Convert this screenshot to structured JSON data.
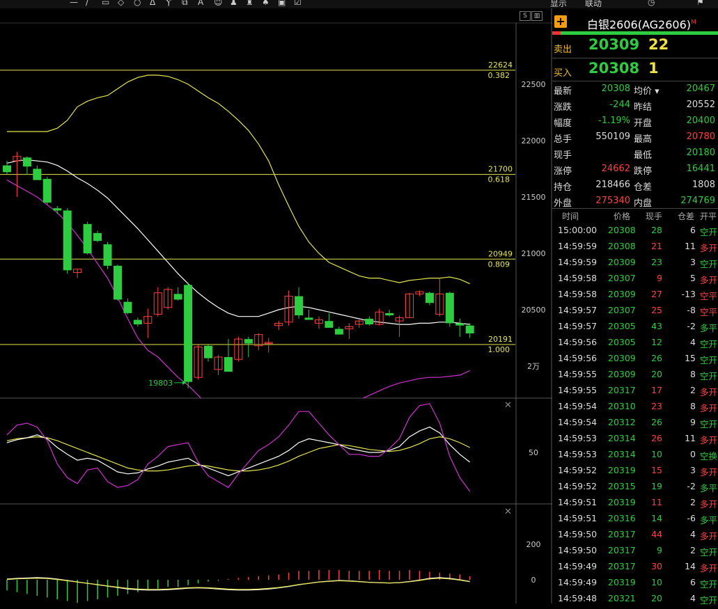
{
  "toolbar": {
    "items": [
      "—",
      "/",
      "▭",
      "◇",
      "○",
      "ᐃ",
      "Ⲩ",
      "⧉",
      "A",
      "☺",
      "♟",
      "♜",
      "♠",
      "▣",
      "☑"
    ],
    "right_items": [
      "显示",
      "联动",
      "◷",
      "⚑"
    ]
  },
  "chart": {
    "y_ticks": [
      {
        "label": "22500",
        "v": 22500
      },
      {
        "label": "22000",
        "v": 22000
      },
      {
        "label": "21500",
        "v": 21500
      },
      {
        "label": "21000",
        "v": 21000
      },
      {
        "label": "20500",
        "v": 20500
      },
      {
        "label": "2万",
        "v": 20000
      }
    ],
    "fib_levels": [
      {
        "price": "22624",
        "ratio": "0.382",
        "v": 22624
      },
      {
        "price": "21700",
        "ratio": "0.618",
        "v": 21700
      },
      {
        "price": "20949",
        "ratio": "0.809",
        "v": 20949
      },
      {
        "price": "20191",
        "ratio": "1.000",
        "v": 20191
      }
    ],
    "low_marker": "19803",
    "low_value": 19803,
    "kdj_tick": "50",
    "macd_ticks": [
      "200",
      "0"
    ],
    "colors": {
      "up": "#ff4040",
      "down": "#2ecc40",
      "fib": "#e6e64c",
      "upper_band": "#e6e64c",
      "mid": "#ffffff",
      "lower_band": "#d030d0"
    }
  },
  "chart_data": {
    "type": "candlestick",
    "candles": [
      {
        "o": 21780,
        "h": 21820,
        "l": 21700,
        "c": 21720
      },
      {
        "o": 21820,
        "h": 21900,
        "l": 21500,
        "c": 21860
      },
      {
        "o": 21850,
        "h": 21860,
        "l": 21700,
        "c": 21770
      },
      {
        "o": 21750,
        "h": 21780,
        "l": 21650,
        "c": 21650
      },
      {
        "o": 21660,
        "h": 21680,
        "l": 21430,
        "c": 21450
      },
      {
        "o": 21400,
        "h": 21420,
        "l": 21350,
        "c": 21380
      },
      {
        "o": 21380,
        "h": 21400,
        "l": 20820,
        "c": 20850
      },
      {
        "o": 20830,
        "h": 20860,
        "l": 20780,
        "c": 20860
      },
      {
        "o": 21260,
        "h": 21280,
        "l": 20990,
        "c": 21000
      },
      {
        "o": 21180,
        "h": 21200,
        "l": 21100,
        "c": 21110
      },
      {
        "o": 21080,
        "h": 21100,
        "l": 20860,
        "c": 20890
      },
      {
        "o": 20890,
        "h": 20900,
        "l": 20580,
        "c": 20590
      },
      {
        "o": 20570,
        "h": 20600,
        "l": 20460,
        "c": 20470
      },
      {
        "o": 20410,
        "h": 20430,
        "l": 20350,
        "c": 20370
      },
      {
        "o": 20380,
        "h": 20510,
        "l": 20250,
        "c": 20440
      },
      {
        "o": 20460,
        "h": 20700,
        "l": 20440,
        "c": 20650
      },
      {
        "o": 20520,
        "h": 20700,
        "l": 20500,
        "c": 20680
      },
      {
        "o": 20640,
        "h": 20700,
        "l": 20580,
        "c": 20590
      },
      {
        "o": 20720,
        "h": 20740,
        "l": 19803,
        "c": 19860
      },
      {
        "o": 19900,
        "h": 20190,
        "l": 19880,
        "c": 20170
      },
      {
        "o": 20180,
        "h": 20190,
        "l": 20040,
        "c": 20070
      },
      {
        "o": 19970,
        "h": 20100,
        "l": 19920,
        "c": 20080
      },
      {
        "o": 20080,
        "h": 20240,
        "l": 20040,
        "c": 19950
      },
      {
        "o": 20060,
        "h": 20260,
        "l": 20040,
        "c": 20240
      },
      {
        "o": 20240,
        "h": 20260,
        "l": 20080,
        "c": 20200
      },
      {
        "o": 20180,
        "h": 20290,
        "l": 20140,
        "c": 20280
      },
      {
        "o": 20200,
        "h": 20250,
        "l": 20120,
        "c": 20210
      },
      {
        "o": 20360,
        "h": 20400,
        "l": 20320,
        "c": 20380
      },
      {
        "o": 20390,
        "h": 20670,
        "l": 20360,
        "c": 20620
      },
      {
        "o": 20620,
        "h": 20700,
        "l": 20420,
        "c": 20450
      },
      {
        "o": 20430,
        "h": 20500,
        "l": 20420,
        "c": 20410
      },
      {
        "o": 20380,
        "h": 20440,
        "l": 20330,
        "c": 20410
      },
      {
        "o": 20400,
        "h": 20470,
        "l": 20350,
        "c": 20340
      },
      {
        "o": 20330,
        "h": 20350,
        "l": 20280,
        "c": 20280
      },
      {
        "o": 20330,
        "h": 20380,
        "l": 20240,
        "c": 20350
      },
      {
        "o": 20370,
        "h": 20420,
        "l": 20340,
        "c": 20400
      },
      {
        "o": 20420,
        "h": 20440,
        "l": 20360,
        "c": 20370
      },
      {
        "o": 20370,
        "h": 20510,
        "l": 20360,
        "c": 20480
      },
      {
        "o": 20470,
        "h": 20500,
        "l": 20440,
        "c": 20450
      },
      {
        "o": 20400,
        "h": 20450,
        "l": 20260,
        "c": 20430
      },
      {
        "o": 20430,
        "h": 20650,
        "l": 20430,
        "c": 20640
      },
      {
        "o": 20640,
        "h": 20670,
        "l": 20620,
        "c": 20660
      },
      {
        "o": 20650,
        "h": 20660,
        "l": 20540,
        "c": 20560
      },
      {
        "o": 20460,
        "h": 20780,
        "l": 20440,
        "c": 20640
      },
      {
        "o": 20650,
        "h": 20660,
        "l": 20350,
        "c": 20380
      },
      {
        "o": 20380,
        "h": 20420,
        "l": 20260,
        "c": 20360
      },
      {
        "o": 20360,
        "h": 20380,
        "l": 20250,
        "c": 20290
      }
    ],
    "upper_band": [
      22080,
      22080,
      22080,
      22080,
      22080,
      22110,
      22180,
      22300,
      22350,
      22380,
      22400,
      22460,
      22520,
      22560,
      22580,
      22580,
      22570,
      22540,
      22500,
      22440,
      22380,
      22330,
      22260,
      22180,
      22090,
      21970,
      21820,
      21610,
      21420,
      21240,
      21100,
      21000,
      20920,
      20880,
      20840,
      20800,
      20780,
      20780,
      20760,
      20740,
      20760,
      20770,
      20780,
      20780,
      20790,
      20770,
      20730
    ],
    "mid_band": [
      21800,
      21820,
      21830,
      21820,
      21810,
      21780,
      21730,
      21670,
      21620,
      21560,
      21490,
      21400,
      21310,
      21220,
      21120,
      21020,
      20920,
      20820,
      20730,
      20650,
      20580,
      20520,
      20470,
      20440,
      20440,
      20440,
      20470,
      20500,
      20520,
      20530,
      20520,
      20500,
      20480,
      20460,
      20440,
      20420,
      20400,
      20390,
      20380,
      20370,
      20370,
      20380,
      20380,
      20390,
      20390,
      20380,
      20370
    ],
    "lower_band": [
      21650,
      21600,
      21550,
      21500,
      21430,
      21360,
      21270,
      21160,
      21040,
      20910,
      20780,
      20610,
      20420,
      20250,
      20140,
      20080,
      19990,
      19900,
      19830,
      19740,
      19650,
      19580,
      19510,
      19460,
      19430,
      19420,
      19420,
      19460,
      19500,
      19540,
      19600,
      19630,
      19640,
      19640,
      19660,
      19700,
      19740,
      19780,
      19820,
      19850,
      19870,
      19890,
      19900,
      19900,
      19910,
      19920,
      19960
    ],
    "kdj_k": [
      60,
      63,
      65,
      68,
      64,
      55,
      48,
      42,
      44,
      42,
      36,
      30,
      28,
      29,
      33,
      36,
      40,
      42,
      44,
      38,
      34,
      30,
      26,
      30,
      34,
      38,
      42,
      46,
      52,
      60,
      64,
      62,
      60,
      58,
      54,
      52,
      50,
      50,
      52,
      56,
      66,
      72,
      76,
      70,
      58,
      48,
      40
    ],
    "kdj_d": [
      62,
      64,
      65,
      66,
      65,
      62,
      58,
      54,
      50,
      46,
      42,
      38,
      34,
      32,
      31,
      31,
      32,
      34,
      36,
      37,
      36,
      34,
      32,
      31,
      31,
      32,
      34,
      37,
      41,
      46,
      50,
      54,
      56,
      58,
      57,
      55,
      53,
      52,
      51,
      52,
      55,
      59,
      64,
      66,
      64,
      60,
      55
    ],
    "kdj_j": [
      68,
      78,
      80,
      76,
      62,
      38,
      24,
      18,
      32,
      34,
      20,
      14,
      16,
      22,
      38,
      46,
      56,
      58,
      60,
      40,
      26,
      20,
      14,
      28,
      40,
      52,
      58,
      66,
      78,
      92,
      92,
      80,
      68,
      58,
      48,
      48,
      46,
      46,
      54,
      64,
      86,
      98,
      100,
      80,
      46,
      24,
      10
    ],
    "macd_hist": [
      -60,
      -70,
      -80,
      -90,
      -100,
      -110,
      -120,
      -130,
      -120,
      -110,
      -100,
      -90,
      -80,
      -70,
      -60,
      -50,
      -40,
      -40,
      -30,
      -20,
      -10,
      -5,
      5,
      10,
      15,
      20,
      25,
      30,
      40,
      50,
      50,
      55,
      55,
      55,
      50,
      50,
      50,
      55,
      50,
      50,
      55,
      50,
      45,
      40,
      35,
      30,
      20
    ]
  },
  "right_panel": {
    "title": "白银2606(AG2606)",
    "title_sup": "M",
    "sell_label": "卖出",
    "sell_price": "20309",
    "sell_vol": "22",
    "buy_label": "买入",
    "buy_price": "20308",
    "buy_vol": "1",
    "quotes": [
      {
        "l1": "最新",
        "v1": "20308",
        "c1": "g",
        "l2": "均价 ▾",
        "v2": "20467",
        "c2": "g"
      },
      {
        "l1": "涨跌",
        "v1": "-244",
        "c1": "g",
        "l2": "昨结",
        "v2": "20552",
        "c2": "w"
      },
      {
        "l1": "幅度",
        "v1": "-1.19%",
        "c1": "g",
        "l2": "开盘",
        "v2": "20400",
        "c2": "g"
      },
      {
        "l1": "总手",
        "v1": "550109",
        "c1": "w",
        "l2": "最高",
        "v2": "20780",
        "c2": "r"
      },
      {
        "l1": "现手",
        "v1": "",
        "c1": "w",
        "l2": "最低",
        "v2": "20180",
        "c2": "g"
      },
      {
        "l1": "涨停",
        "v1": "24662",
        "c1": "r",
        "l2": "跌停",
        "v2": "16441",
        "c2": "g"
      },
      {
        "l1": "持仓",
        "v1": "218466",
        "c1": "w",
        "l2": "仓差",
        "v2": "1808",
        "c2": "w"
      },
      {
        "l1": "外盘",
        "v1": "275340",
        "c1": "r",
        "l2": "内盘",
        "v2": "274769",
        "c2": "g"
      }
    ],
    "tick_headers": [
      "时间",
      "价格",
      "现手",
      "仓差",
      "开平"
    ],
    "ticks": [
      {
        "t": "15:00:00",
        "p": "20308",
        "v": "28",
        "vc": "g",
        "oi": "6",
        "ty": "空开",
        "tc": "g"
      },
      {
        "t": "14:59:59",
        "p": "20308",
        "v": "21",
        "vc": "r",
        "oi": "11",
        "ty": "多开",
        "tc": "r"
      },
      {
        "t": "14:59:59",
        "p": "20309",
        "v": "23",
        "vc": "g",
        "oi": "3",
        "ty": "空开",
        "tc": "g"
      },
      {
        "t": "14:59:58",
        "p": "20307",
        "v": "9",
        "vc": "r",
        "oi": "5",
        "ty": "多开",
        "tc": "r"
      },
      {
        "t": "14:59:58",
        "p": "20309",
        "v": "27",
        "vc": "r",
        "oi": "-13",
        "ty": "空平",
        "tc": "r"
      },
      {
        "t": "14:59:57",
        "p": "20307",
        "v": "25",
        "vc": "r",
        "oi": "-8",
        "ty": "空平",
        "tc": "r"
      },
      {
        "t": "14:59:57",
        "p": "20305",
        "v": "43",
        "vc": "g",
        "oi": "-2",
        "ty": "多平",
        "tc": "g"
      },
      {
        "t": "14:59:56",
        "p": "20305",
        "v": "12",
        "vc": "g",
        "oi": "4",
        "ty": "空开",
        "tc": "g"
      },
      {
        "t": "14:59:56",
        "p": "20309",
        "v": "26",
        "vc": "g",
        "oi": "15",
        "ty": "空开",
        "tc": "g"
      },
      {
        "t": "14:59:55",
        "p": "20309",
        "v": "20",
        "vc": "g",
        "oi": "8",
        "ty": "空开",
        "tc": "g"
      },
      {
        "t": "14:59:55",
        "p": "20317",
        "v": "17",
        "vc": "r",
        "oi": "2",
        "ty": "多开",
        "tc": "r"
      },
      {
        "t": "14:59:54",
        "p": "20310",
        "v": "23",
        "vc": "r",
        "oi": "8",
        "ty": "多开",
        "tc": "r"
      },
      {
        "t": "14:59:54",
        "p": "20312",
        "v": "26",
        "vc": "g",
        "oi": "9",
        "ty": "空开",
        "tc": "g"
      },
      {
        "t": "14:59:53",
        "p": "20314",
        "v": "26",
        "vc": "r",
        "oi": "11",
        "ty": "多开",
        "tc": "r"
      },
      {
        "t": "14:59:53",
        "p": "20314",
        "v": "10",
        "vc": "g",
        "oi": "0",
        "ty": "空换",
        "tc": "g"
      },
      {
        "t": "14:59:52",
        "p": "20319",
        "v": "15",
        "vc": "r",
        "oi": "3",
        "ty": "多开",
        "tc": "r"
      },
      {
        "t": "14:59:52",
        "p": "20315",
        "v": "19",
        "vc": "g",
        "oi": "-2",
        "ty": "多平",
        "tc": "g"
      },
      {
        "t": "14:59:51",
        "p": "20319",
        "v": "11",
        "vc": "r",
        "oi": "2",
        "ty": "多开",
        "tc": "r"
      },
      {
        "t": "14:59:51",
        "p": "20316",
        "v": "14",
        "vc": "g",
        "oi": "-6",
        "ty": "多平",
        "tc": "g"
      },
      {
        "t": "14:59:50",
        "p": "20317",
        "v": "44",
        "vc": "r",
        "oi": "4",
        "ty": "多开",
        "tc": "r"
      },
      {
        "t": "14:59:50",
        "p": "20317",
        "v": "9",
        "vc": "g",
        "oi": "2",
        "ty": "空开",
        "tc": "g"
      },
      {
        "t": "14:59:49",
        "p": "20317",
        "v": "30",
        "vc": "r",
        "oi": "14",
        "ty": "多开",
        "tc": "r"
      },
      {
        "t": "14:59:49",
        "p": "20319",
        "v": "10",
        "vc": "g",
        "oi": "6",
        "ty": "空开",
        "tc": "g"
      },
      {
        "t": "14:59:48",
        "p": "20321",
        "v": "20",
        "vc": "g",
        "oi": "4",
        "ty": "空开",
        "tc": "g"
      }
    ]
  }
}
